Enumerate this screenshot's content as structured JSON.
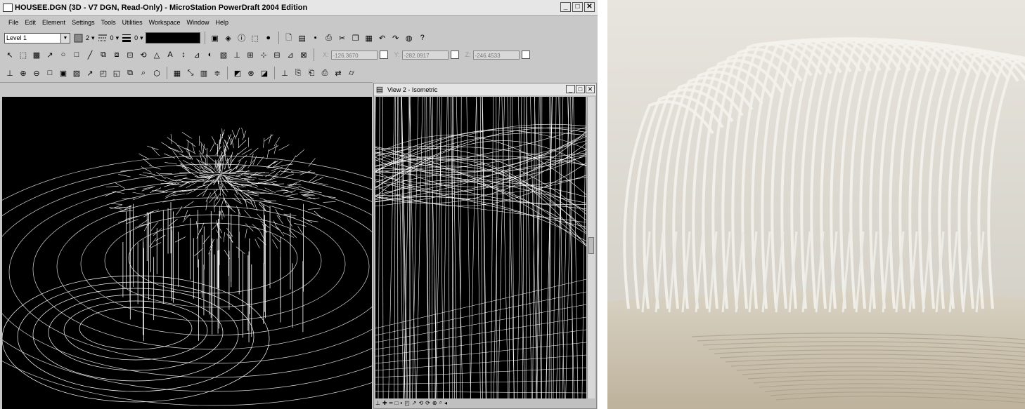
{
  "window": {
    "title": "HOUSEE.DGN (3D - V7 DGN, Read-Only) - MicroStation PowerDraft 2004 Edition",
    "controls": [
      "_",
      "□",
      "✕"
    ]
  },
  "menu": {
    "items": [
      "File",
      "Edit",
      "Element",
      "Settings",
      "Tools",
      "Utilities",
      "Workspace",
      "Window",
      "Help"
    ]
  },
  "attributes": {
    "level": "Level 1",
    "color_index": "2",
    "style_index": "0",
    "weight_index": "0"
  },
  "coordinates": {
    "x_label": "X:",
    "x_value": "-126.3670",
    "y_label": "Y:",
    "y_value": "-282.0917",
    "z_label": "Z:",
    "z_value": "-246.4533"
  },
  "view2": {
    "title": "View 2 - Isometric"
  },
  "colors": {
    "chrome": "#c8c8c8",
    "viewport": "#000000",
    "wireframe": "#ffffff"
  }
}
